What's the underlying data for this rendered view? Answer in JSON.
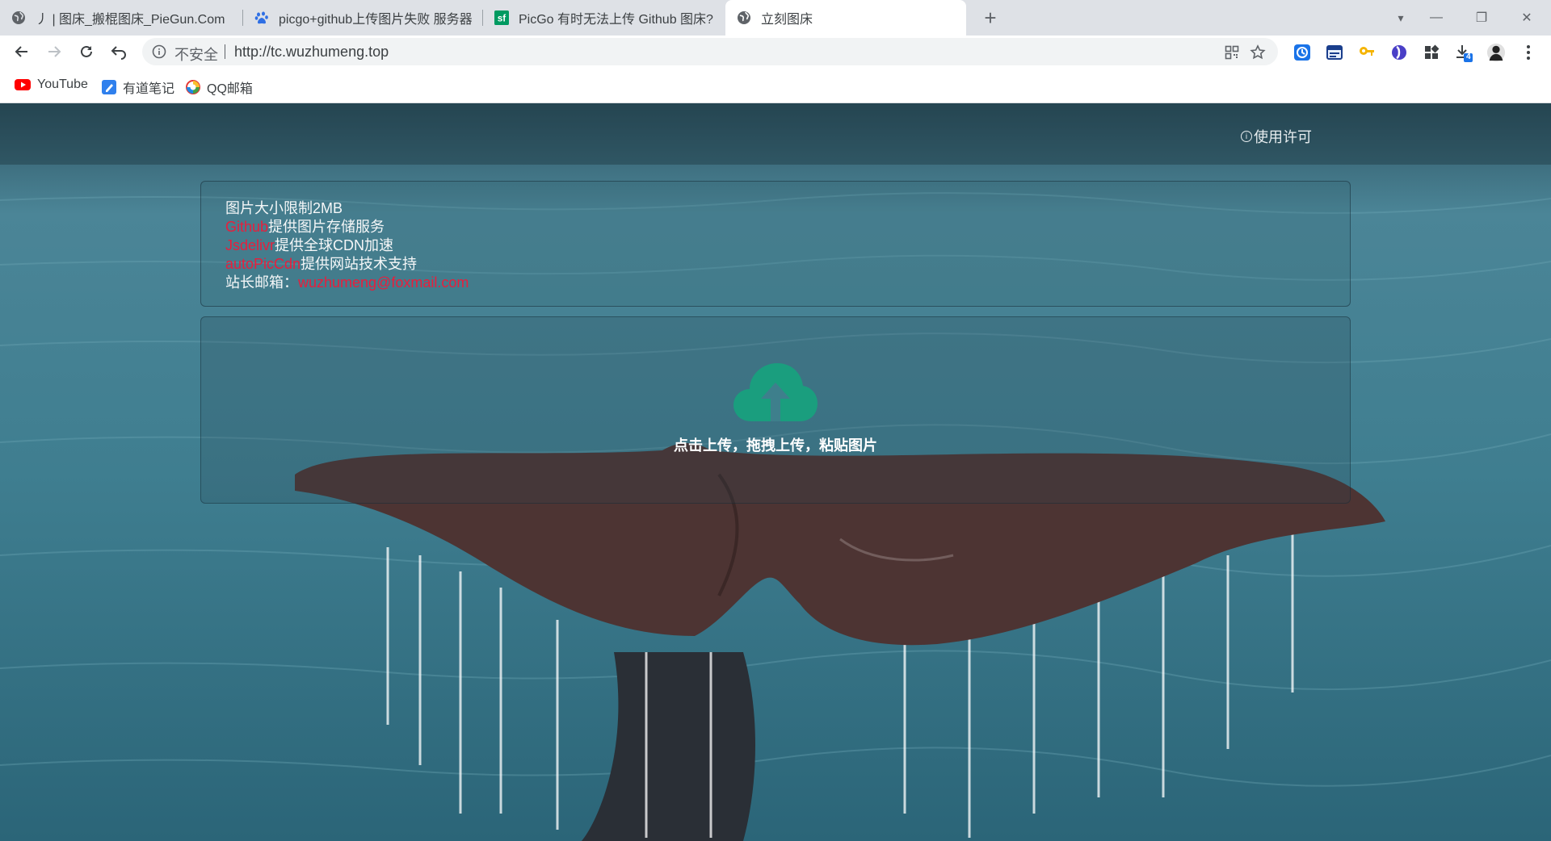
{
  "tabs": [
    {
      "title": "丿 | 图床_搬棍图床_PieGun.Com",
      "icon": "globe-icon",
      "active": false
    },
    {
      "title": "picgo+github上传图片失败 服务器",
      "icon": "baidu-paw-icon",
      "active": false
    },
    {
      "title": "PicGo 有时无法上传 Github 图床?",
      "icon": "segmentfault-icon",
      "active": false
    },
    {
      "title": "立刻图床",
      "icon": "globe-icon",
      "active": true
    }
  ],
  "new_tab_label": "+",
  "window_controls": {
    "tab_search": "▾",
    "minimize": "—",
    "restore": "❐",
    "close": "✕"
  },
  "address_bar": {
    "security_label": "不安全",
    "url": "http://tc.wuzhumeng.top"
  },
  "extensions": {
    "download_badge": "4"
  },
  "bookmarks": [
    {
      "label": "YouTube",
      "icon": "youtube-icon"
    },
    {
      "label": "有道笔记",
      "icon": "youdao-note-icon"
    },
    {
      "label": "QQ邮箱",
      "icon": "qq-mail-icon"
    }
  ],
  "page": {
    "license_label": "使用许可",
    "info": {
      "line1": "图片大小限制2MB",
      "line2_link": "Github",
      "line2_text": "提供图片存储服务",
      "line3_link": "Jsdelivr",
      "line3_text": "提供全球CDN加速",
      "line4_link": "autoPicCdn",
      "line4_text": "提供网站技术支持",
      "line5_label": "站长邮箱：",
      "line5_email": "wuzhumeng@foxmail.com"
    },
    "upload_text": "点击上传，拖拽上传，粘贴图片",
    "colors": {
      "accent_red": "#e81e3c",
      "cloud_green": "#1a9e7e"
    }
  }
}
